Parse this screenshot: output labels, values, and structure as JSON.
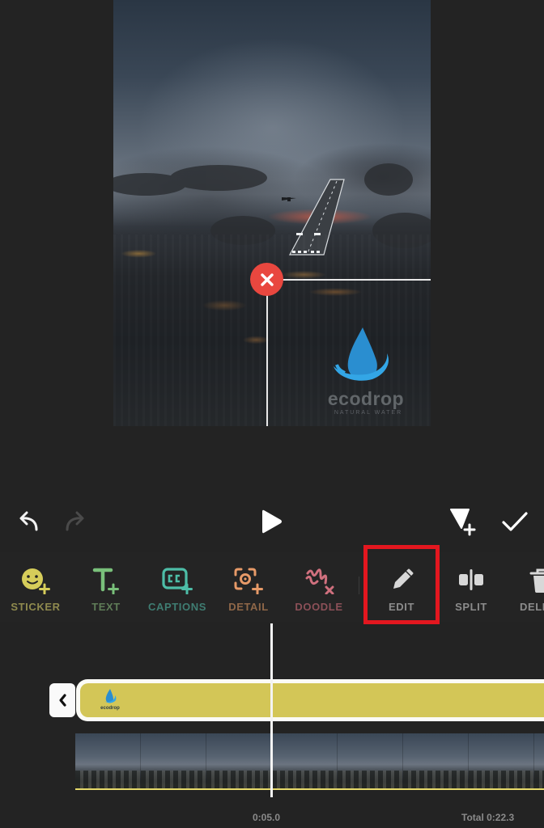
{
  "preview": {
    "watermark_brand": "ecodrop",
    "watermark_tagline": "NATURAL WATER",
    "remove_sticker_icon": "close-icon"
  },
  "controls": {
    "undo_icon": "undo-icon",
    "redo_icon": "redo-icon",
    "play_icon": "play-icon",
    "add_marker_icon": "add-marker-icon",
    "done_icon": "checkmark-icon"
  },
  "tools": [
    {
      "label": "STICKER",
      "icon": "sticker-add-icon",
      "color": "#d6cd5a",
      "label_color": "#8f8a4e"
    },
    {
      "label": "TEXT",
      "icon": "text-add-icon",
      "color": "#79c07a",
      "label_color": "#5f7d58"
    },
    {
      "label": "CAPTIONS",
      "icon": "captions-add-icon",
      "color": "#4dbda7",
      "label_color": "#3f7d72"
    },
    {
      "label": "DETAIL",
      "icon": "detail-add-icon",
      "color": "#e79a68",
      "label_color": "#8f6748"
    },
    {
      "label": "DOODLE",
      "icon": "doodle-add-icon",
      "color": "#d0707e",
      "label_color": "#8c5058"
    },
    {
      "label": "EDIT",
      "icon": "pencil-icon",
      "color": "#d8d8d8",
      "label_color": "#8c8c8c"
    },
    {
      "label": "SPLIT",
      "icon": "split-icon",
      "color": "#d8d8d8",
      "label_color": "#8c8c8c"
    },
    {
      "label": "DELETE",
      "icon": "trash-icon",
      "color": "#d8d8d8",
      "label_color": "#8c8c8c"
    }
  ],
  "highlight_color": "#e3171f",
  "timeline": {
    "sticker_track_label": "ecodrop",
    "sticker_track_color": "#d3c657",
    "current_time": "0:05.0",
    "total_time": "Total 0:22.3"
  }
}
